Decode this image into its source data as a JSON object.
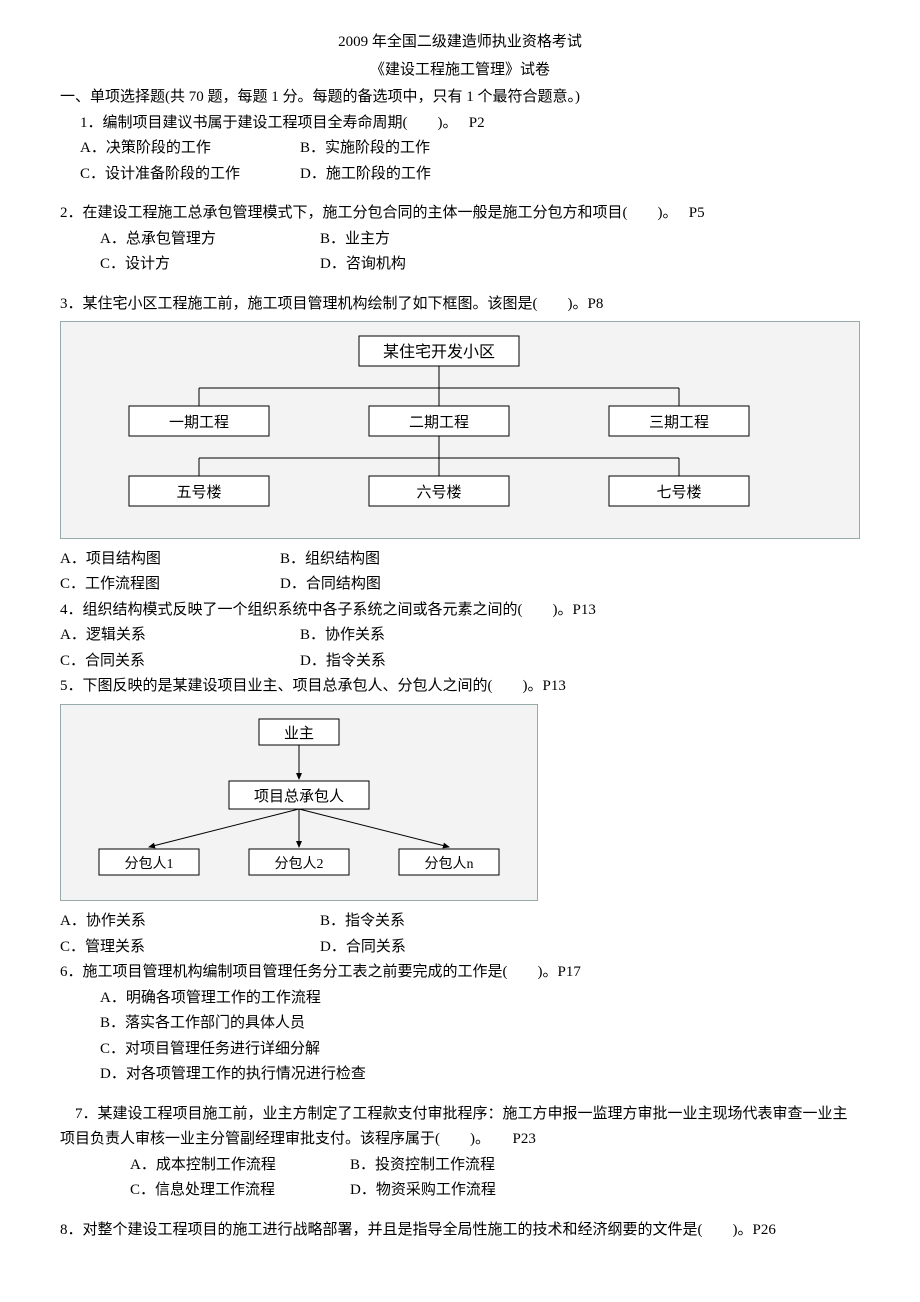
{
  "header": {
    "line1": "2009 年全国二级建造师执业资格考试",
    "line2": "《建设工程施工管理》试卷"
  },
  "section": "一、单项选择题(共 70 题，每题 1 分。每题的备选项中，只有 1 个最符合题意。)",
  "q1": {
    "stem": "1．编制项目建议书属于建设工程项目全寿命周期(　　)。　 P2",
    "a": "A．决策阶段的工作",
    "b": "B．实施阶段的工作",
    "c": "C．设计准备阶段的工作",
    "d": "D．施工阶段的工作"
  },
  "q2": {
    "stem": "2．在建设工程施工总承包管理模式下，施工分包合同的主体一般是施工分包方和项目(　　)。　 P5",
    "a": "A．总承包管理方",
    "b": "B．业主方",
    "c": "C．设计方",
    "d": "D．咨询机构"
  },
  "q3": {
    "stem": "3．某住宅小区工程施工前，施工项目管理机构绘制了如下框图。该图是(　　)。P8",
    "dia": {
      "top": "某住宅开发小区",
      "mid": [
        "一期工程",
        "二期工程",
        "三期工程"
      ],
      "bot": [
        "五号楼",
        "六号楼",
        "七号楼"
      ]
    },
    "a": "A．项目结构图",
    "b": "B．组织结构图",
    "c": "C．工作流程图",
    "d": "D．合同结构图"
  },
  "q4": {
    "stem": "4．组织结构模式反映了一个组织系统中各子系统之间或各元素之间的(　　)。P13",
    "a": "A．逻辑关系",
    "b": "B．协作关系",
    "c": "C．合同关系",
    "d": "D．指令关系"
  },
  "q5": {
    "stem": "5．下图反映的是某建设项目业主、项目总承包人、分包人之间的(　　)。P13",
    "dia": {
      "top": "业主",
      "mid": "项目总承包人",
      "bot": [
        "分包人1",
        "分包人2",
        "分包人n"
      ]
    },
    "a": "A．协作关系",
    "b": "B．指令关系",
    "c": "C．管理关系",
    "d": "D．合同关系"
  },
  "q6": {
    "stem": "6．施工项目管理机构编制项目管理任务分工表之前要完成的工作是(　　)。P17",
    "a": "A．明确各项管理工作的工作流程",
    "b": "B．落实各工作部门的具体人员",
    "c": "C．对项目管理任务进行详细分解",
    "d": "D．对各项管理工作的执行情况进行检查"
  },
  "q7": {
    "stem": "　7．某建设工程项目施工前，业主方制定了工程款支付审批程序：施工方申报一监理方审批一业主现场代表审查一业主项目负责人审核一业主分管副经理审批支付。该程序属于(　　)。　　P23",
    "a": "A．成本控制工作流程",
    "b": "B．投资控制工作流程",
    "c": "C．信息处理工作流程",
    "d": "D．物资采购工作流程"
  },
  "q8": {
    "stem": "8．对整个建设工程项目的施工进行战略部署，并且是指导全局性施工的技术和经济纲要的文件是(　　)。P26"
  }
}
